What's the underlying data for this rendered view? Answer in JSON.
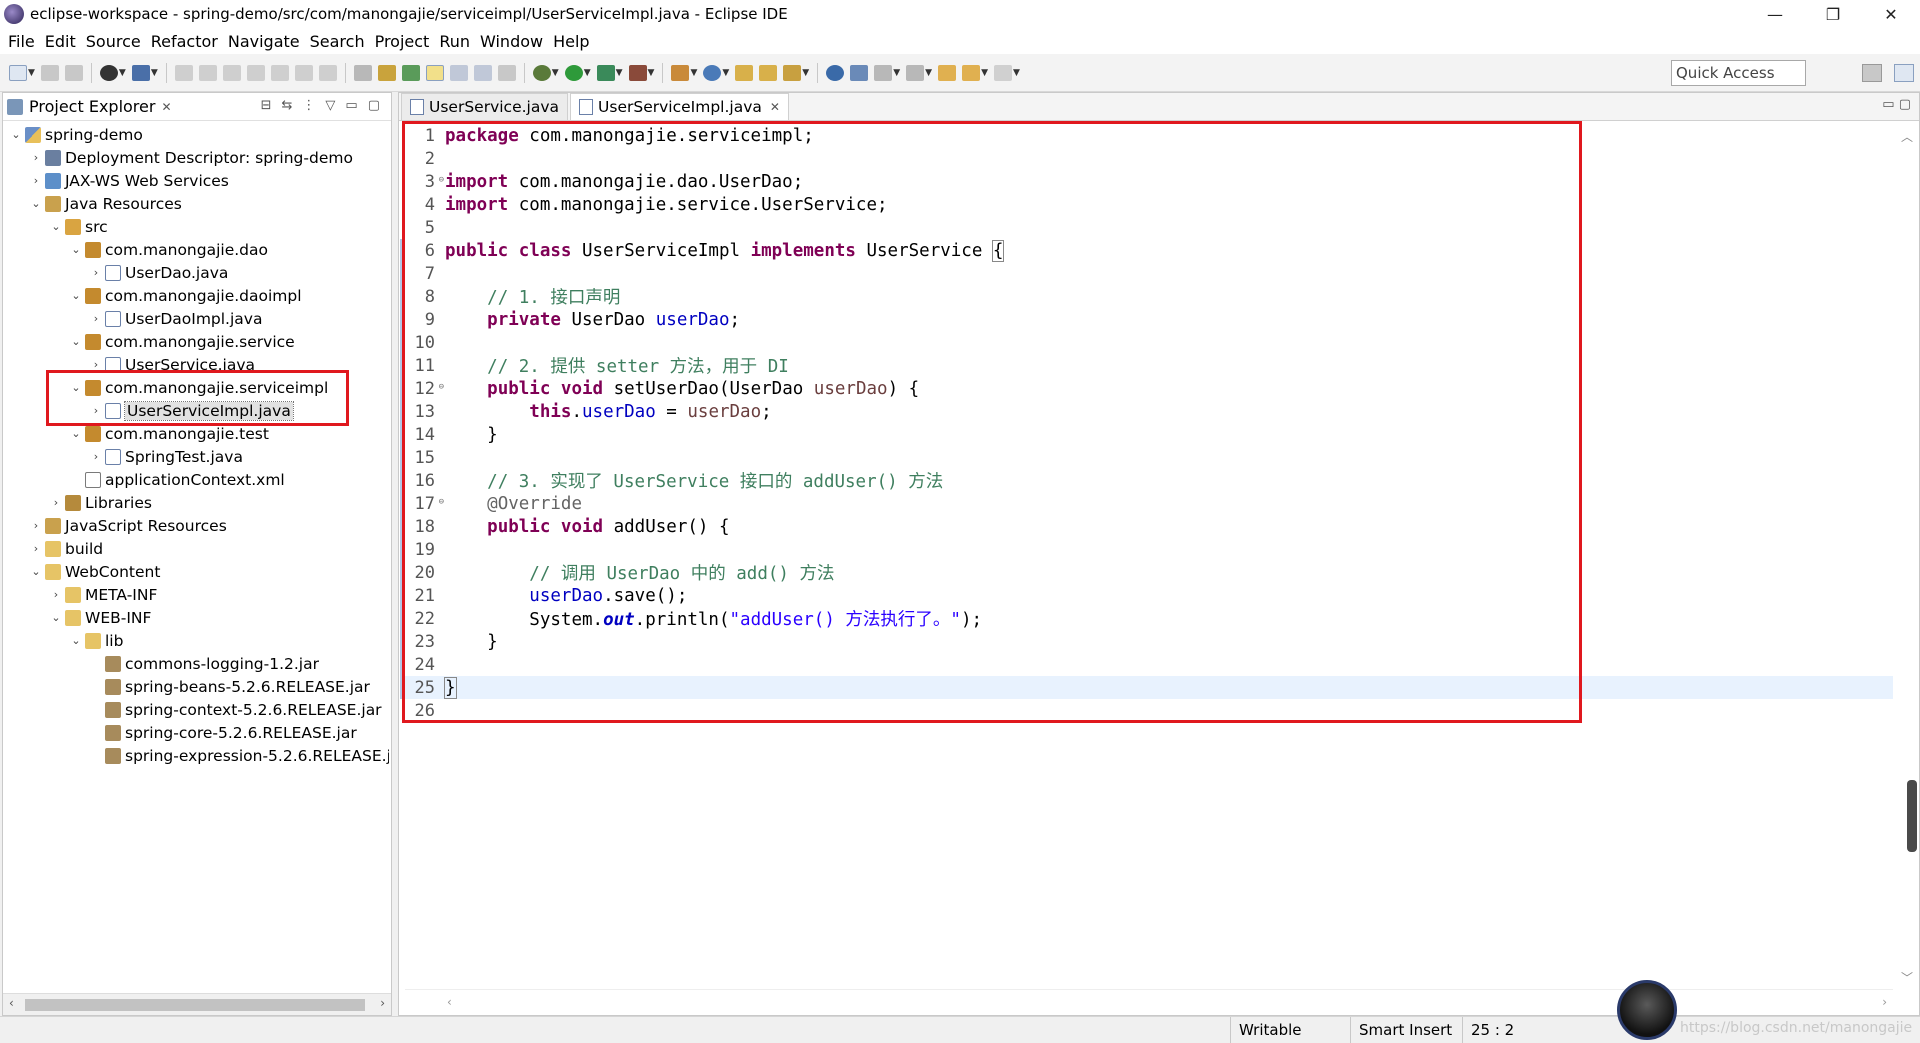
{
  "window": {
    "title": "eclipse-workspace - spring-demo/src/com/manongajie/serviceimpl/UserServiceImpl.java - Eclipse IDE",
    "minimize": "—",
    "restore": "❐",
    "close": "✕"
  },
  "menu": [
    "File",
    "Edit",
    "Source",
    "Refactor",
    "Navigate",
    "Search",
    "Project",
    "Run",
    "Window",
    "Help"
  ],
  "quick_access": "Quick Access",
  "explorer": {
    "title": "Project Explorer",
    "close": "✕",
    "tree": [
      {
        "label": "spring-demo",
        "icon": "project-icon",
        "arrow": "⌄"
      },
      {
        "label": "Deployment Descriptor: spring-demo",
        "icon": "deployment-descriptor-icon",
        "arrow": "›"
      },
      {
        "label": "JAX-WS Web Services",
        "icon": "web-services-icon",
        "arrow": "›"
      },
      {
        "label": "Java Resources",
        "icon": "java-resources-icon",
        "arrow": "⌄"
      },
      {
        "label": "src",
        "icon": "source-folder-icon",
        "arrow": "⌄"
      },
      {
        "label": "com.manongajie.dao",
        "icon": "package-icon",
        "arrow": "⌄"
      },
      {
        "label": "UserDao.java",
        "icon": "java-interface-file-icon",
        "arrow": "›"
      },
      {
        "label": "com.manongajie.daoimpl",
        "icon": "package-icon",
        "arrow": "⌄"
      },
      {
        "label": "UserDaoImpl.java",
        "icon": "java-file-icon",
        "arrow": "›"
      },
      {
        "label": "com.manongajie.service",
        "icon": "package-icon",
        "arrow": "⌄"
      },
      {
        "label": "UserService.java",
        "icon": "java-interface-file-icon",
        "arrow": "›"
      },
      {
        "label": "com.manongajie.serviceimpl",
        "icon": "package-icon",
        "arrow": "⌄"
      },
      {
        "label": "UserServiceImpl.java",
        "icon": "java-file-icon",
        "arrow": "›"
      },
      {
        "label": "com.manongajie.test",
        "icon": "package-icon",
        "arrow": "⌄"
      },
      {
        "label": "SpringTest.java",
        "icon": "java-file-icon",
        "arrow": "›"
      },
      {
        "label": "applicationContext.xml",
        "icon": "xml-file-icon",
        "arrow": ""
      },
      {
        "label": "Libraries",
        "icon": "libraries-icon",
        "arrow": "›"
      },
      {
        "label": "JavaScript Resources",
        "icon": "javascript-resources-icon",
        "arrow": "›"
      },
      {
        "label": "build",
        "icon": "folder-icon",
        "arrow": "›"
      },
      {
        "label": "WebContent",
        "icon": "folder-icon",
        "arrow": "⌄"
      },
      {
        "label": "META-INF",
        "icon": "folder-icon",
        "arrow": "›"
      },
      {
        "label": "WEB-INF",
        "icon": "folder-icon",
        "arrow": "⌄"
      },
      {
        "label": "lib",
        "icon": "folder-icon",
        "arrow": "⌄"
      },
      {
        "label": "commons-logging-1.2.jar",
        "icon": "jar-icon",
        "arrow": ""
      },
      {
        "label": "spring-beans-5.2.6.RELEASE.jar",
        "icon": "jar-icon",
        "arrow": ""
      },
      {
        "label": "spring-context-5.2.6.RELEASE.jar",
        "icon": "jar-icon",
        "arrow": ""
      },
      {
        "label": "spring-core-5.2.6.RELEASE.jar",
        "icon": "jar-icon",
        "arrow": ""
      },
      {
        "label": "spring-expression-5.2.6.RELEASE.jar",
        "icon": "jar-icon",
        "arrow": ""
      }
    ]
  },
  "editor": {
    "tabs": [
      {
        "label": "UserService.java",
        "active": false
      },
      {
        "label": "UserServiceImpl.java",
        "active": true,
        "close": "✕"
      }
    ],
    "lines": [
      "1",
      "2",
      "3",
      "4",
      "5",
      "6",
      "7",
      "8",
      "9",
      "10",
      "11",
      "12",
      "13",
      "14",
      "15",
      "16",
      "17",
      "18",
      "19",
      "20",
      "21",
      "22",
      "23",
      "24",
      "25",
      "26"
    ],
    "code": {
      "l1_kw": "package",
      "l1_rest": " com.manongajie.serviceimpl;",
      "l3_kw": "import",
      "l3_rest": " com.manongajie.dao.UserDao;",
      "l4_kw": "import",
      "l4_rest": " com.manongajie.service.UserService;",
      "l6_kw1": "public",
      "l6_kw2": "class",
      "l6_name": " UserServiceImpl ",
      "l6_kw3": "implements",
      "l6_iface": " UserService ",
      "l6_brace": "{",
      "l8_comment": "// 1. 接口声明",
      "l9_kw": "private",
      "l9_type": " UserDao ",
      "l9_field": "userDao",
      "l9_end": ";",
      "l11_comment": "// 2. 提供 setter 方法，用于 DI",
      "l12_kw1": "public",
      "l12_kw2": "void",
      "l12_a": " setUserDao(UserDao ",
      "l12_param": "userDao",
      "l12_b": ") {",
      "l13_kw": "this",
      "l13_dot": ".",
      "l13_field": "userDao",
      "l13_eq": " = ",
      "l13_param": "userDao",
      "l13_end": ";",
      "l14": "}",
      "l16_comment": "// 3. 实现了 UserService 接口的 addUser() 方法",
      "l17_ann": "@Override",
      "l18_kw1": "public",
      "l18_kw2": "void",
      "l18_rest": " addUser() {",
      "l20_comment": "// 调用 UserDao 中的 add() 方法",
      "l21_field": "userDao",
      "l21_rest": ".save();",
      "l22_a": "System.",
      "l22_out": "out",
      "l22_b": ".println(",
      "l22_str": "\"addUser() 方法执行了。\"",
      "l22_c": ");",
      "l23": "}",
      "l25": "}"
    }
  },
  "status": {
    "writable": "Writable",
    "insert_mode": "Smart Insert",
    "position": "25 : 2"
  },
  "watermark": "https://blog.csdn.net/manongajie"
}
